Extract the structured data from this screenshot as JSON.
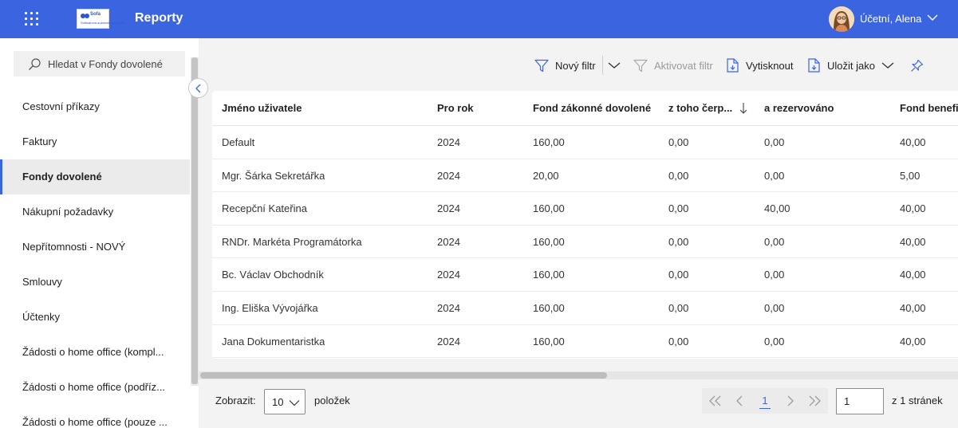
{
  "header": {
    "app_title": "Reporty",
    "logo": {
      "brand": "Sofa",
      "subtitle": "Softwarová automatizace s.r.o."
    },
    "user_name": "Účetní, Alena",
    "accent_color": "#3b64e0"
  },
  "sidebar": {
    "search_placeholder": "Hledat v Fondy dovolené",
    "items": [
      {
        "label": "Cestovní příkazy",
        "active": false
      },
      {
        "label": "Faktury",
        "active": false
      },
      {
        "label": "Fondy dovolené",
        "active": true
      },
      {
        "label": "Nákupní požadavky",
        "active": false
      },
      {
        "label": "Nepřítomnosti - NOVÝ",
        "active": false
      },
      {
        "label": "Smlouvy",
        "active": false
      },
      {
        "label": "Účtenky",
        "active": false
      },
      {
        "label": "Žádosti o home office (kompl...",
        "active": false
      },
      {
        "label": "Žádosti o home office (podříz...",
        "active": false
      },
      {
        "label": "Žádosti o home office (pouze ...",
        "active": false
      }
    ]
  },
  "toolbar": {
    "new_filter": "Nový filtr",
    "activate_filter": "Aktivovat filtr",
    "print": "Vytisknout",
    "save_as": "Uložit jako"
  },
  "table": {
    "columns": [
      "Jméno uživatele",
      "Pro rok",
      "Fond zákonné dovolené",
      "z toho čerp...",
      "a rezervováno",
      "Fond benefi"
    ],
    "sort_column": "z toho čerp...",
    "sort_direction": "descending",
    "rows": [
      [
        "Default",
        "2024",
        "160,00",
        "0,00",
        "0,00",
        "40,00"
      ],
      [
        "Mgr. Šárka Sekretářka",
        "2024",
        "20,00",
        "0,00",
        "0,00",
        "5,00"
      ],
      [
        "Recepční Kateřina",
        "2024",
        "160,00",
        "0,00",
        "40,00",
        "40,00"
      ],
      [
        "RNDr. Markéta Programátorka",
        "2024",
        "160,00",
        "0,00",
        "0,00",
        "40,00"
      ],
      [
        "Bc. Václav Obchodník",
        "2024",
        "160,00",
        "0,00",
        "0,00",
        "40,00"
      ],
      [
        "Ing. Eliška Vývojářka",
        "2024",
        "160,00",
        "0,00",
        "0,00",
        "40,00"
      ],
      [
        "Jana Dokumentaristka",
        "2024",
        "160,00",
        "0,00",
        "0,00",
        "40,00"
      ]
    ]
  },
  "footer": {
    "show_label": "Zobrazit:",
    "page_size": "10",
    "items_label": "položek",
    "current_page": "1",
    "page_input": "1",
    "total_label": "z 1 stránek"
  }
}
